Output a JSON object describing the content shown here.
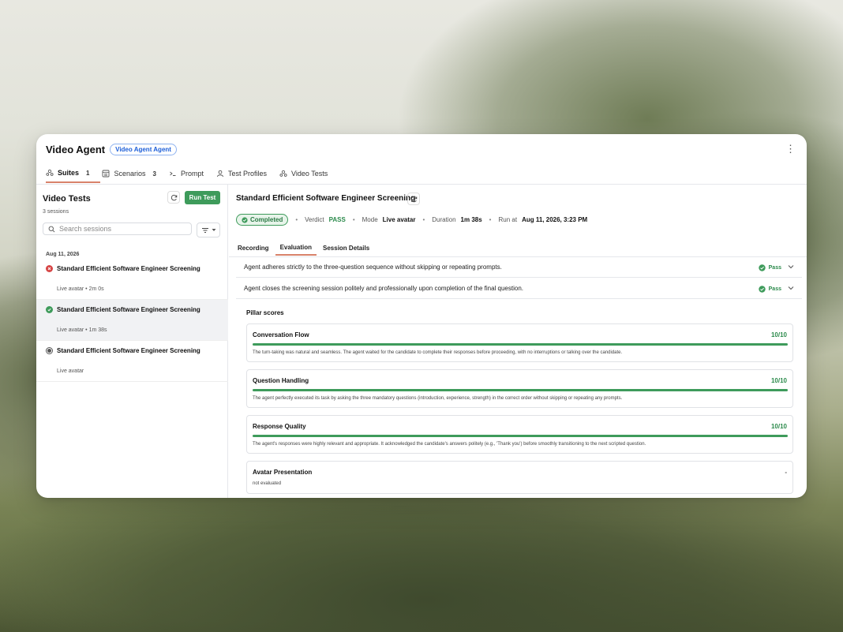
{
  "header": {
    "title": "Video Agent",
    "badge": "Video Agent Agent",
    "more_icon": "⋮"
  },
  "tabs": [
    {
      "label": "Suites",
      "count": "1",
      "icon": "users-icon"
    },
    {
      "label": "Scenarios",
      "count": "3",
      "icon": "table-icon"
    },
    {
      "label": "Prompt",
      "icon": "terminal-icon"
    },
    {
      "label": "Test Profiles",
      "icon": "user-icon"
    },
    {
      "label": "Video Tests",
      "icon": "users-icon"
    }
  ],
  "sidebar": {
    "title": "Video Tests",
    "count_text": "3 sessions",
    "run_label": "Run Test",
    "search_placeholder": "Search sessions",
    "date_group": "Aug 11, 2026",
    "sessions": [
      {
        "title": "Standard Efficient Software Engineer Screening",
        "meta": "Live avatar • 2m 0s",
        "status": "failed",
        "color": "#d64545"
      },
      {
        "title": "Standard Efficient Software Engineer Screening",
        "meta": "Live avatar • 1m 38s",
        "status": "completed",
        "color": "#3e9b5b"
      },
      {
        "title": "Standard Efficient Software Engineer Screening",
        "meta": "Live avatar",
        "status": "pending",
        "color": "#555555"
      }
    ]
  },
  "detail": {
    "title": "Standard Efficient Software Engineer Screening",
    "status": "Completed",
    "verdict_label": "Verdict",
    "verdict": "PASS",
    "mode_label": "Mode",
    "mode": "Live avatar",
    "duration_label": "Duration",
    "duration": "1m 38s",
    "run_label": "Run at",
    "run_at": "Aug 11, 2026, 3:23 PM",
    "tabs": [
      "Recording",
      "Evaluation",
      "Session Details"
    ],
    "criteria": [
      {
        "text": "Agent adheres strictly to the three-question sequence without skipping or repeating prompts.",
        "result": "Pass"
      },
      {
        "text": "Agent closes the screening session politely and professionally upon completion of the final question.",
        "result": "Pass"
      }
    ],
    "pillar_heading": "Pillar scores",
    "pillars": [
      {
        "name": "Conversation Flow",
        "score": "10/10",
        "fill": 1.0,
        "desc": "The turn-taking was natural and seamless. The agent waited for the candidate to complete their responses before proceeding, with no interruptions or talking over the candidate."
      },
      {
        "name": "Question Handling",
        "score": "10/10",
        "fill": 1.0,
        "desc": "The agent perfectly executed its task by asking the three mandatory questions (introduction, experience, strength) in the correct order without skipping or repeating any prompts."
      },
      {
        "name": "Response Quality",
        "score": "10/10",
        "fill": 1.0,
        "desc": "The agent's responses were highly relevant and appropriate. It acknowledged the candidate's answers politely (e.g., 'Thank you') before smoothly transitioning to the next scripted question."
      },
      {
        "name": "Avatar Presentation",
        "score": "-",
        "fill": 0,
        "desc": "not evaluated"
      }
    ]
  },
  "colors": {
    "accent_green": "#3e9b5b",
    "tab_underline": "#d8826a",
    "badge_blue": "#1d5fd8"
  }
}
